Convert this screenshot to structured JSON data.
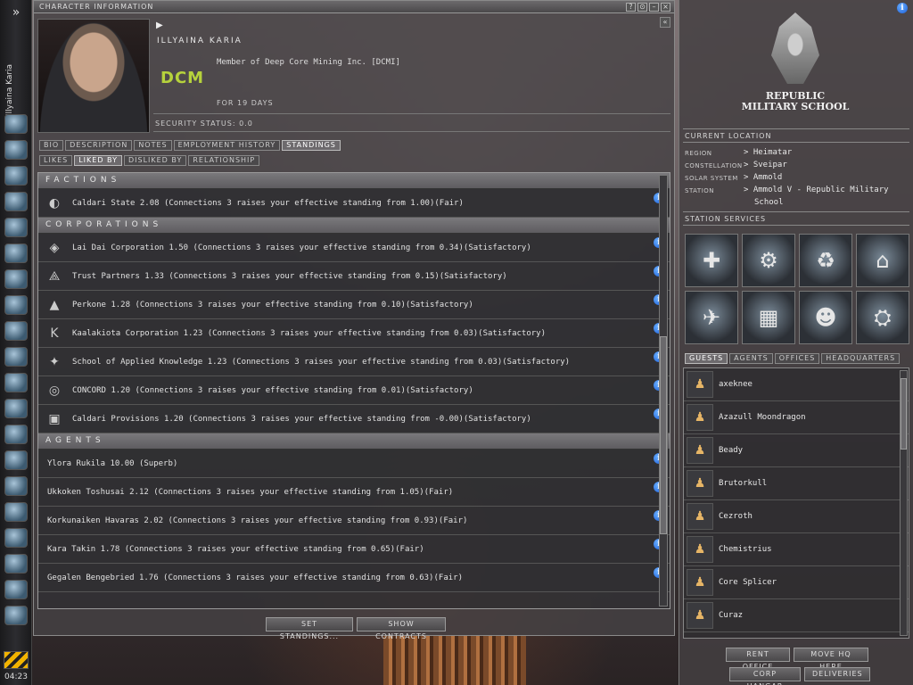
{
  "neocom": {
    "expand_glyph": "»",
    "pilot_name": "Illyaina Karia",
    "clock": "04:23",
    "buttons": [
      "people-icon",
      "mail-icon",
      "notepad-icon",
      "market-icon",
      "map-icon",
      "assets-icon",
      "fitting-icon",
      "drones-icon",
      "star-map-icon",
      "cargo-icon",
      "skills-icon",
      "calculator-icon",
      "help-icon",
      "wallet-icon",
      "help-desk-icon",
      "browser-icon",
      "info-icon",
      "character-icon",
      "ship-icon",
      "log-icon"
    ]
  },
  "charwin": {
    "title": "CHARACTER INFORMATION",
    "title_buttons": [
      "?",
      "⊙",
      "–",
      "×"
    ],
    "collapse_glyph": "«",
    "arrow_glyph": "▶",
    "pilot_name": "ILLYAINA KARIA",
    "corp_logo_text": "DCM",
    "membership": "Member of Deep Core Mining Inc. [DCMI]",
    "days": "FOR 19 DAYS",
    "security_status": "SECURITY STATUS: 0.0",
    "tabs": [
      "BIO",
      "DESCRIPTION",
      "NOTES",
      "EMPLOYMENT HISTORY",
      "STANDINGS"
    ],
    "active_tab": "STANDINGS",
    "subtabs": [
      "LIKES",
      "LIKED BY",
      "DISLIKED BY",
      "RELATIONSHIP"
    ],
    "active_subtab": "LIKED BY",
    "sections": {
      "factions": {
        "title": "FACTIONS",
        "rows": [
          {
            "icon": "caldari-logo-icon",
            "glyph": "◐",
            "text": "Caldari State 2.08 (Connections 3 raises your effective standing from 1.00)(Fair)"
          }
        ]
      },
      "corporations": {
        "title": "CORPORATIONS",
        "rows": [
          {
            "icon": "lai-dai-logo-icon",
            "glyph": "◈",
            "text": "Lai Dai Corporation 1.50 (Connections 3 raises your effective standing from 0.34)(Satisfactory)"
          },
          {
            "icon": "trust-partners-logo-icon",
            "glyph": "⟁",
            "text": "Trust Partners 1.33 (Connections 3 raises your effective standing from 0.15)(Satisfactory)"
          },
          {
            "icon": "perkone-logo-icon",
            "glyph": "▲",
            "text": "Perkone 1.28 (Connections 3 raises your effective standing from 0.10)(Satisfactory)"
          },
          {
            "icon": "kaalakiota-logo-icon",
            "glyph": "K",
            "text": "Kaalakiota Corporation 1.23 (Connections 3 raises your effective standing from 0.03)(Satisfactory)"
          },
          {
            "icon": "school-applied-knowledge-logo-icon",
            "glyph": "✦",
            "text": "School of Applied Knowledge 1.23 (Connections 3 raises your effective standing from 0.03)(Satisfactory)"
          },
          {
            "icon": "concord-logo-icon",
            "glyph": "◎",
            "text": "CONCORD 1.20 (Connections 3 raises your effective standing from 0.01)(Satisfactory)"
          },
          {
            "icon": "caldari-provisions-logo-icon",
            "glyph": "▣",
            "text": "Caldari Provisions 1.20 (Connections 3 raises your effective standing from -0.00)(Satisfactory)"
          }
        ]
      },
      "agents": {
        "title": "AGENTS",
        "rows": [
          {
            "text": "Ylora Rukila 10.00 (Superb)"
          },
          {
            "text": "Ukkoken Toshusai 2.12 (Connections 3 raises your effective standing from 1.05)(Fair)"
          },
          {
            "text": "Korkunaiken Havaras 2.02 (Connections 3 raises your effective standing from 0.93)(Fair)"
          },
          {
            "text": "Kara Takin 1.78 (Connections 3 raises your effective standing from 0.65)(Fair)"
          },
          {
            "text": "Gegalen Bengebried 1.76 (Connections 3 raises your effective standing from 0.63)(Fair)"
          }
        ]
      }
    },
    "info_glyph": "i",
    "buttons": {
      "set_standings": "SET STANDINGS...",
      "show_contracts": "SHOW CONTRACTS"
    }
  },
  "station": {
    "school_name_line1": "REPUBLIC",
    "school_name_line2": "MILITARY SCHOOL",
    "current_location_title": "CURRENT LOCATION",
    "location": {
      "region_label": "REGION",
      "region": "> Heimatar",
      "constellation_label": "CONSTELLATION",
      "constellation": "> Sveipar",
      "solar_system_label": "SOLAR SYSTEM",
      "solar_system": "> Ammold",
      "station_label": "STATION",
      "station_line1": "> Ammold V - Republic Military",
      "station_line2": "School"
    },
    "services_title": "STATION SERVICES",
    "services": [
      {
        "name": "medical-clone-icon",
        "glyph": "✚"
      },
      {
        "name": "repair-shop-icon",
        "glyph": "⚙"
      },
      {
        "name": "reprocessing-icon",
        "glyph": "♻"
      },
      {
        "name": "market-icon",
        "glyph": "⌂"
      },
      {
        "name": "fitting-icon",
        "glyph": "✈"
      },
      {
        "name": "factory-icon",
        "glyph": "▦"
      },
      {
        "name": "bounty-office-icon",
        "glyph": "☻"
      },
      {
        "name": "ship-hangar-icon",
        "glyph": "⛭"
      }
    ],
    "tabs": [
      "GUESTS",
      "AGENTS",
      "OFFICES",
      "HEADQUARTERS"
    ],
    "active_tab": "GUESTS",
    "guest_glyph": "♟",
    "guests": [
      "axeknee",
      "Azazull Moondragon",
      "Beady",
      "Brutorkull",
      "Cezroth",
      "Chemistrius",
      "Core Splicer",
      "Curaz"
    ],
    "buttons": {
      "rent_office": "RENT OFFICE",
      "move_hq": "MOVE HQ HERE",
      "corp_hangar": "CORP HANGAR",
      "deliveries": "DELIVERIES"
    }
  }
}
